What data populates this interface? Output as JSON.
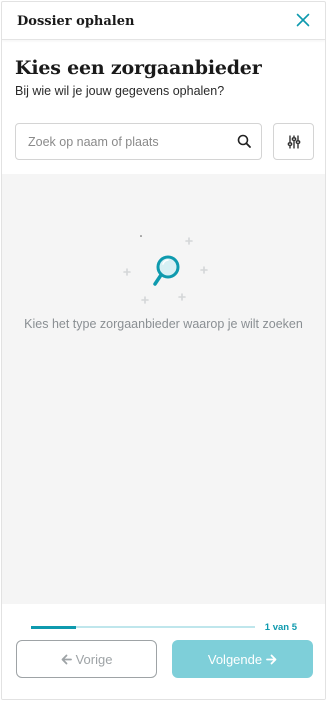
{
  "header": {
    "title": "Dossier ophalen"
  },
  "main": {
    "title": "Kies een zorgaanbieder",
    "subtitle": "Bij wie wil je jouw gegevens ophalen?"
  },
  "search": {
    "placeholder": "Zoek op naam of plaats",
    "value": ""
  },
  "empty_state": {
    "message": "Kies het type zorgaanbieder waarop je wilt zoeken"
  },
  "progress": {
    "current": 1,
    "total": 5,
    "label": "1 van 5",
    "fraction": 0.2
  },
  "footer": {
    "prev_label": "Vorige",
    "next_label": "Volgende"
  },
  "colors": {
    "accent": "#0e9aae",
    "accent_light": "#7ecfd9",
    "track": "#bfe6ec",
    "empty_bg": "#f5f5f5"
  }
}
